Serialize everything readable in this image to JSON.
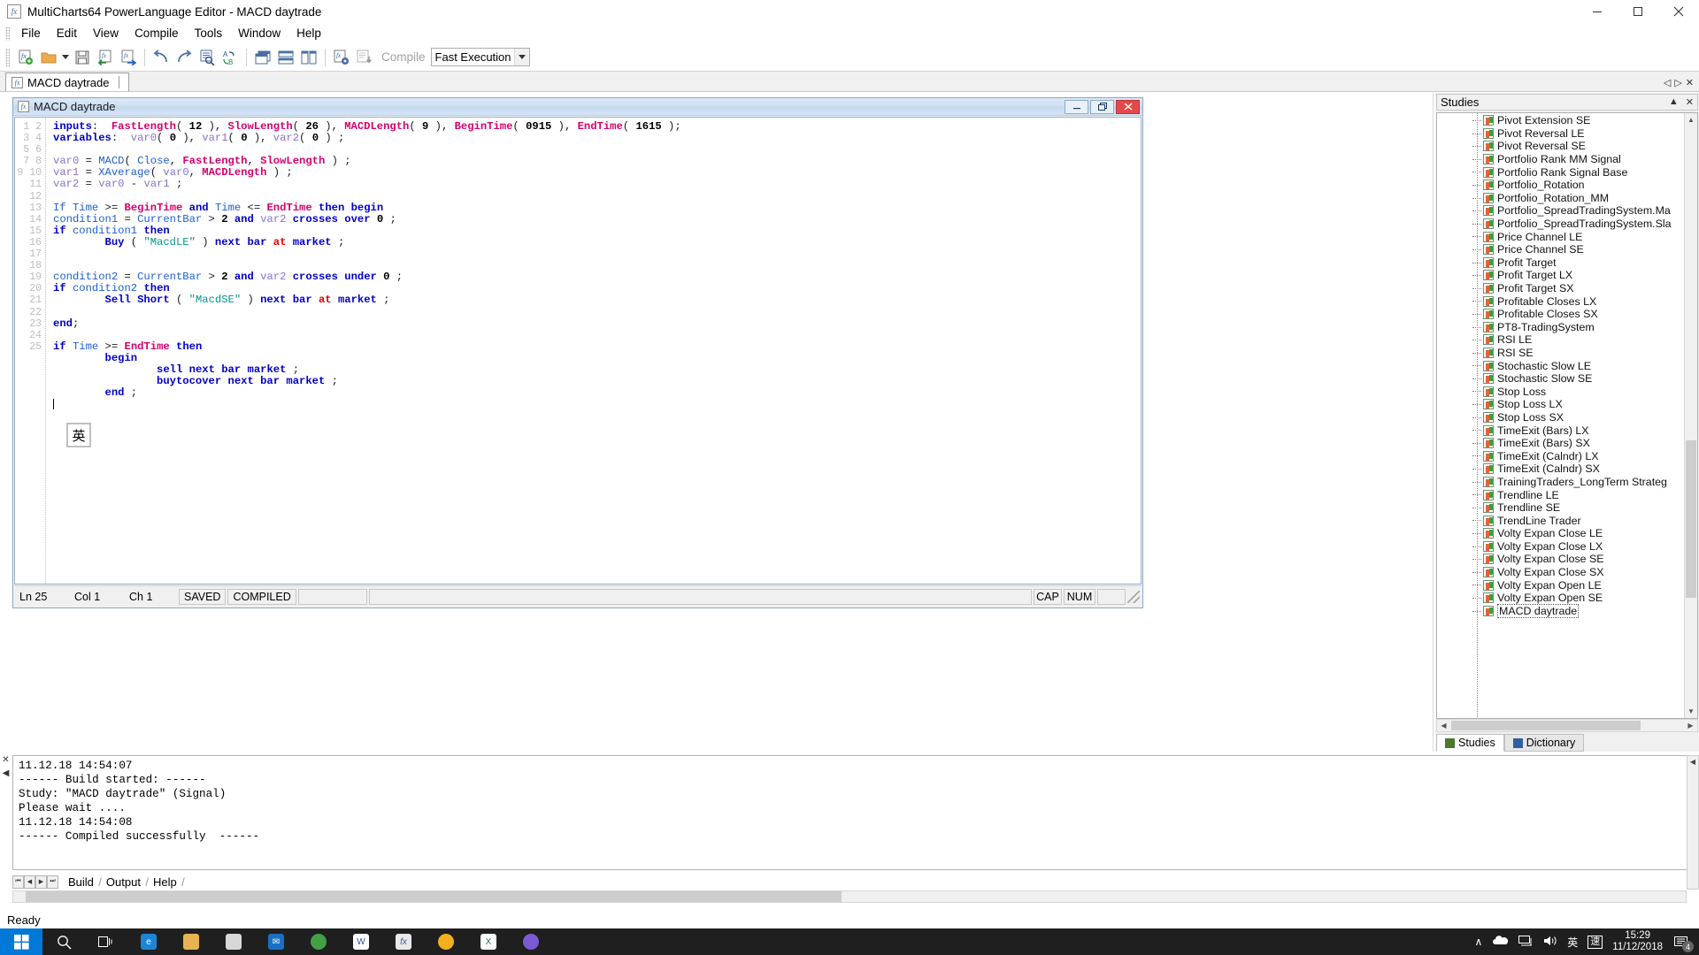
{
  "window": {
    "title": "MultiCharts64 PowerLanguage Editor - MACD daytrade",
    "icon": "function-icon",
    "minimize_label": "─",
    "maximize_label": "❐",
    "close_label": "✕"
  },
  "menu": {
    "items": [
      "File",
      "Edit",
      "View",
      "Compile",
      "Tools",
      "Window",
      "Help"
    ]
  },
  "toolbar": {
    "compile_label": "Compile",
    "execution_mode": "Fast Execution",
    "buttons": [
      "new-study-icon",
      "open-folder-icon",
      "open-dropdown-icon",
      "save-icon",
      "import-study-icon",
      "export-study-icon",
      "undo-icon",
      "redo-icon",
      "find-icon",
      "replace-icon",
      "cascade-windows-icon",
      "tile-horizontal-icon",
      "tile-vertical-icon",
      "compile-settings-icon",
      "compile-icon"
    ]
  },
  "doc_tabs": {
    "tabs": [
      {
        "label": "MACD daytrade",
        "active": true
      }
    ],
    "nav_prev": "◁",
    "nav_next": "▷",
    "close": "✕"
  },
  "mdi": {
    "title": "MACD daytrade",
    "minimize": "─",
    "restore": "❐",
    "close": "✕",
    "ime_indicator": "英"
  },
  "editor": {
    "line_numbers": [
      1,
      2,
      3,
      4,
      5,
      6,
      7,
      8,
      9,
      10,
      11,
      12,
      13,
      14,
      15,
      16,
      17,
      18,
      19,
      20,
      21,
      22,
      23,
      24,
      25
    ],
    "lines": [
      "inputs:  FastLength( 12 ), SlowLength( 26 ), MACDLength( 9 ), BeginTime( 0915 ), EndTime( 1615 );",
      "variables:  var0( 0 ), var1( 0 ), var2( 0 ) ;",
      "",
      "var0 = MACD( Close, FastLength, SlowLength ) ;",
      "var1 = XAverage( var0, MACDLength ) ;",
      "var2 = var0 - var1 ;",
      "",
      "If Time >= BeginTime and Time <= EndTime then begin",
      "condition1 = CurrentBar > 2 and var2 crosses over 0 ;",
      "if condition1 then",
      "        Buy ( \"MacdLE\" ) next bar at market ;",
      "",
      "",
      "condition2 = CurrentBar > 2 and var2 crosses under 0 ;",
      "if condition2 then",
      "        Sell Short ( \"MacdSE\" ) next bar at market ;",
      "",
      "end;",
      "",
      "if Time >= EndTime then",
      "        begin",
      "                sell next bar market ;",
      "                buytocover next bar market ;",
      "        end ;",
      ""
    ]
  },
  "editor_status": {
    "line": "Ln 25",
    "column": "Col 1",
    "character": "Ch 1",
    "saved": "SAVED",
    "compiled": "COMPILED",
    "cap": "CAP",
    "num": "NUM"
  },
  "studies": {
    "panel_title": "Studies",
    "collapse_icon": "▲",
    "close_icon": "✕",
    "items": [
      {
        "label": "Pivot Extension SE",
        "selected": false
      },
      {
        "label": "Pivot Reversal LE",
        "selected": false
      },
      {
        "label": "Pivot Reversal SE",
        "selected": false
      },
      {
        "label": "Portfolio Rank MM Signal",
        "selected": false
      },
      {
        "label": "Portfolio Rank Signal Base",
        "selected": false
      },
      {
        "label": "Portfolio_Rotation",
        "selected": false
      },
      {
        "label": "Portfolio_Rotation_MM",
        "selected": false
      },
      {
        "label": "Portfolio_SpreadTradingSystem.Mа",
        "selected": false
      },
      {
        "label": "Portfolio_SpreadTradingSystem.Sla",
        "selected": false
      },
      {
        "label": "Price Channel LE",
        "selected": false
      },
      {
        "label": "Price Channel SE",
        "selected": false
      },
      {
        "label": "Profit Target",
        "selected": false
      },
      {
        "label": "Profit Target LX",
        "selected": false
      },
      {
        "label": "Profit Target SX",
        "selected": false
      },
      {
        "label": "Profitable Closes LX",
        "selected": false
      },
      {
        "label": "Profitable Closes SX",
        "selected": false
      },
      {
        "label": "PT8-TradingSystem",
        "selected": false
      },
      {
        "label": "RSI LE",
        "selected": false
      },
      {
        "label": "RSI SE",
        "selected": false
      },
      {
        "label": "Stochastic Slow LE",
        "selected": false
      },
      {
        "label": "Stochastic Slow SE",
        "selected": false
      },
      {
        "label": "Stop Loss",
        "selected": false
      },
      {
        "label": "Stop Loss LX",
        "selected": false
      },
      {
        "label": "Stop Loss SX",
        "selected": false
      },
      {
        "label": "TimeExit (Bars) LX",
        "selected": false
      },
      {
        "label": "TimeExit (Bars) SX",
        "selected": false
      },
      {
        "label": "TimeExit (Calndr) LX",
        "selected": false
      },
      {
        "label": "TimeExit (Calndr) SX",
        "selected": false
      },
      {
        "label": "TrainingTraders_LongTerm Strateg",
        "selected": false
      },
      {
        "label": "Trendline LE",
        "selected": false
      },
      {
        "label": "Trendline SE",
        "selected": false
      },
      {
        "label": "TrendLine Trader",
        "selected": false
      },
      {
        "label": "Volty Expan Close LE",
        "selected": false
      },
      {
        "label": "Volty Expan Close LX",
        "selected": false
      },
      {
        "label": "Volty Expan Close SE",
        "selected": false
      },
      {
        "label": "Volty Expan Close SX",
        "selected": false
      },
      {
        "label": "Volty Expan Open LE",
        "selected": false
      },
      {
        "label": "Volty Expan Open SE",
        "selected": false
      },
      {
        "label": "MACD daytrade",
        "selected": true
      }
    ],
    "tabs": [
      {
        "label": "Studies",
        "active": true
      },
      {
        "label": "Dictionary",
        "active": false
      }
    ]
  },
  "output": {
    "close_icon": "✕",
    "collapse_icon": "◀",
    "text": "11.12.18 14:54:07\n------ Build started: ------\nStudy: \"MACD daytrade\" (Signal)\nPlease wait ....\n11.12.18 14:54:08\n------ Compiled successfully  ------",
    "tabs": [
      {
        "label": "Build",
        "active": true
      },
      {
        "label": "Output",
        "active": false
      },
      {
        "label": "Help",
        "active": false
      }
    ],
    "nav": [
      "⏮",
      "◀",
      "▶",
      "⏭"
    ]
  },
  "app_status": {
    "text": "Ready"
  },
  "taskbar": {
    "start_icon": "windows-icon",
    "items": [
      "search-icon",
      "task-view-icon",
      "edge-icon",
      "file-explorer-icon",
      "store-icon",
      "mail-icon",
      "chrome-icon",
      "word-icon",
      "powerlanguage-editor-icon",
      "chrome2-icon",
      "excel-icon",
      "browser-icon"
    ],
    "tray": {
      "chevron": "∧",
      "cloud": "onedrive-icon",
      "network": "network-icon",
      "volume": "volume-icon",
      "ime": "英",
      "ime_mode": "速",
      "time": "15:29",
      "date": "11/12/2018",
      "notifications": "4"
    }
  },
  "colors": {
    "accent": "#0078d7",
    "keyword": "#0000c8",
    "identifier": "#d6006c",
    "string": "#009688",
    "function": "#1e5fd4",
    "close_red": "#e24b4b"
  }
}
